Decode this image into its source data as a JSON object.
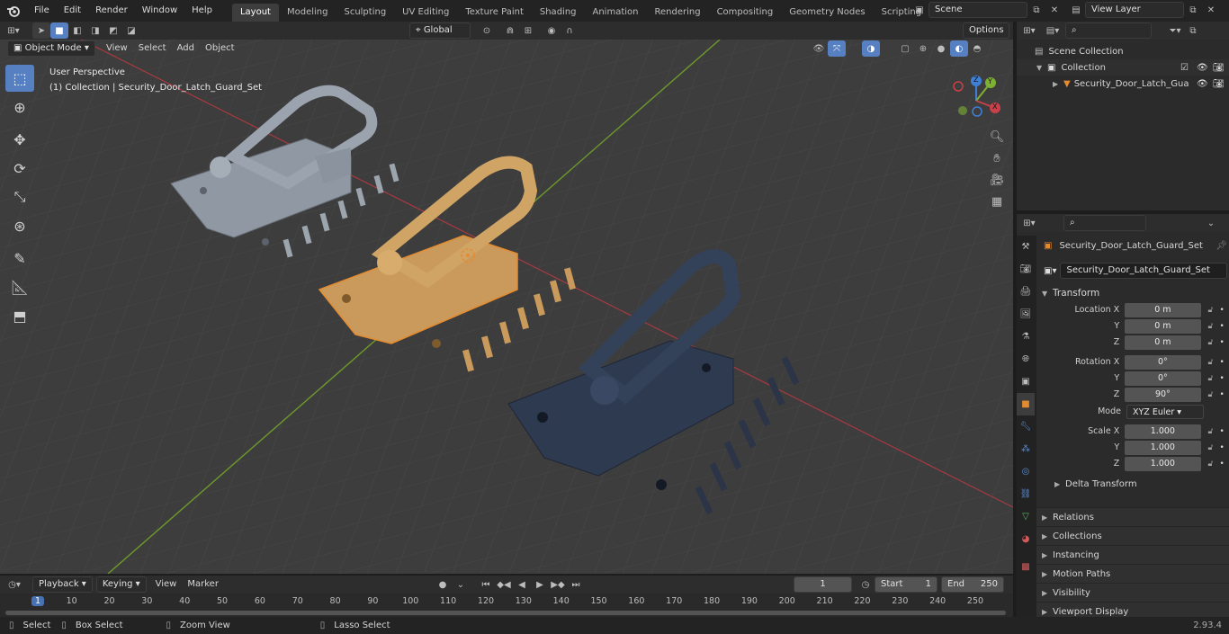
{
  "app": {
    "version": "2.93.4"
  },
  "menu": [
    "File",
    "Edit",
    "Render",
    "Window",
    "Help"
  ],
  "workspaces": [
    "Layout",
    "Modeling",
    "Sculpting",
    "UV Editing",
    "Texture Paint",
    "Shading",
    "Animation",
    "Rendering",
    "Compositing",
    "Geometry Nodes",
    "Scripting"
  ],
  "active_workspace": "Layout",
  "scene": {
    "name": "Scene",
    "view_layer": "View Layer"
  },
  "viewport_header": {
    "mode": "Object Mode",
    "menus": [
      "View",
      "Select",
      "Add",
      "Object"
    ],
    "orientation": "Global",
    "options": "Options"
  },
  "viewport": {
    "perspective": "User Perspective",
    "collection_info": "(1) Collection | Security_Door_Latch_Guard_Set",
    "gizmo_axes": {
      "x": "X",
      "y": "Y",
      "z": "Z"
    }
  },
  "outliner": {
    "scene_collection": "Scene Collection",
    "collection": "Collection",
    "object": "Security_Door_Latch_Gua"
  },
  "properties": {
    "object_name": "Security_Door_Latch_Guard_Set",
    "data_name": "Security_Door_Latch_Guard_Set",
    "transform_title": "Transform",
    "location": {
      "label": "Location X",
      "x": "0 m",
      "y": "0 m",
      "z": "0 m"
    },
    "rotation": {
      "label": "Rotation X",
      "x": "0°",
      "y": "0°",
      "z": "90°"
    },
    "mode_label": "Mode",
    "mode_value": "XYZ Euler",
    "scale": {
      "label": "Scale X",
      "x": "1.000",
      "y": "1.000",
      "z": "1.000"
    },
    "axis_labels": {
      "y": "Y",
      "z": "Z"
    },
    "delta": "Delta Transform",
    "panels": [
      "Relations",
      "Collections",
      "Instancing",
      "Motion Paths",
      "Visibility",
      "Viewport Display"
    ]
  },
  "timeline": {
    "menus": [
      "Playback",
      "Keying",
      "View",
      "Marker"
    ],
    "current_frame": "1",
    "start_label": "Start",
    "start": "1",
    "end_label": "End",
    "end": "250",
    "ticks": [
      "1",
      "10",
      "20",
      "30",
      "40",
      "50",
      "60",
      "70",
      "80",
      "90",
      "100",
      "110",
      "120",
      "130",
      "140",
      "150",
      "160",
      "170",
      "180",
      "190",
      "200",
      "210",
      "220",
      "230",
      "240",
      "250"
    ]
  },
  "statusbar": {
    "select": "Select",
    "box_select": "Box Select",
    "zoom_view": "Zoom View",
    "lasso_select": "Lasso Select"
  },
  "colors": {
    "accent": "#5680c2",
    "x_axis": "#c8404a",
    "y_axis": "#7eb032",
    "z_axis": "#3f7fd8",
    "object_orange": "#e58b2f"
  }
}
